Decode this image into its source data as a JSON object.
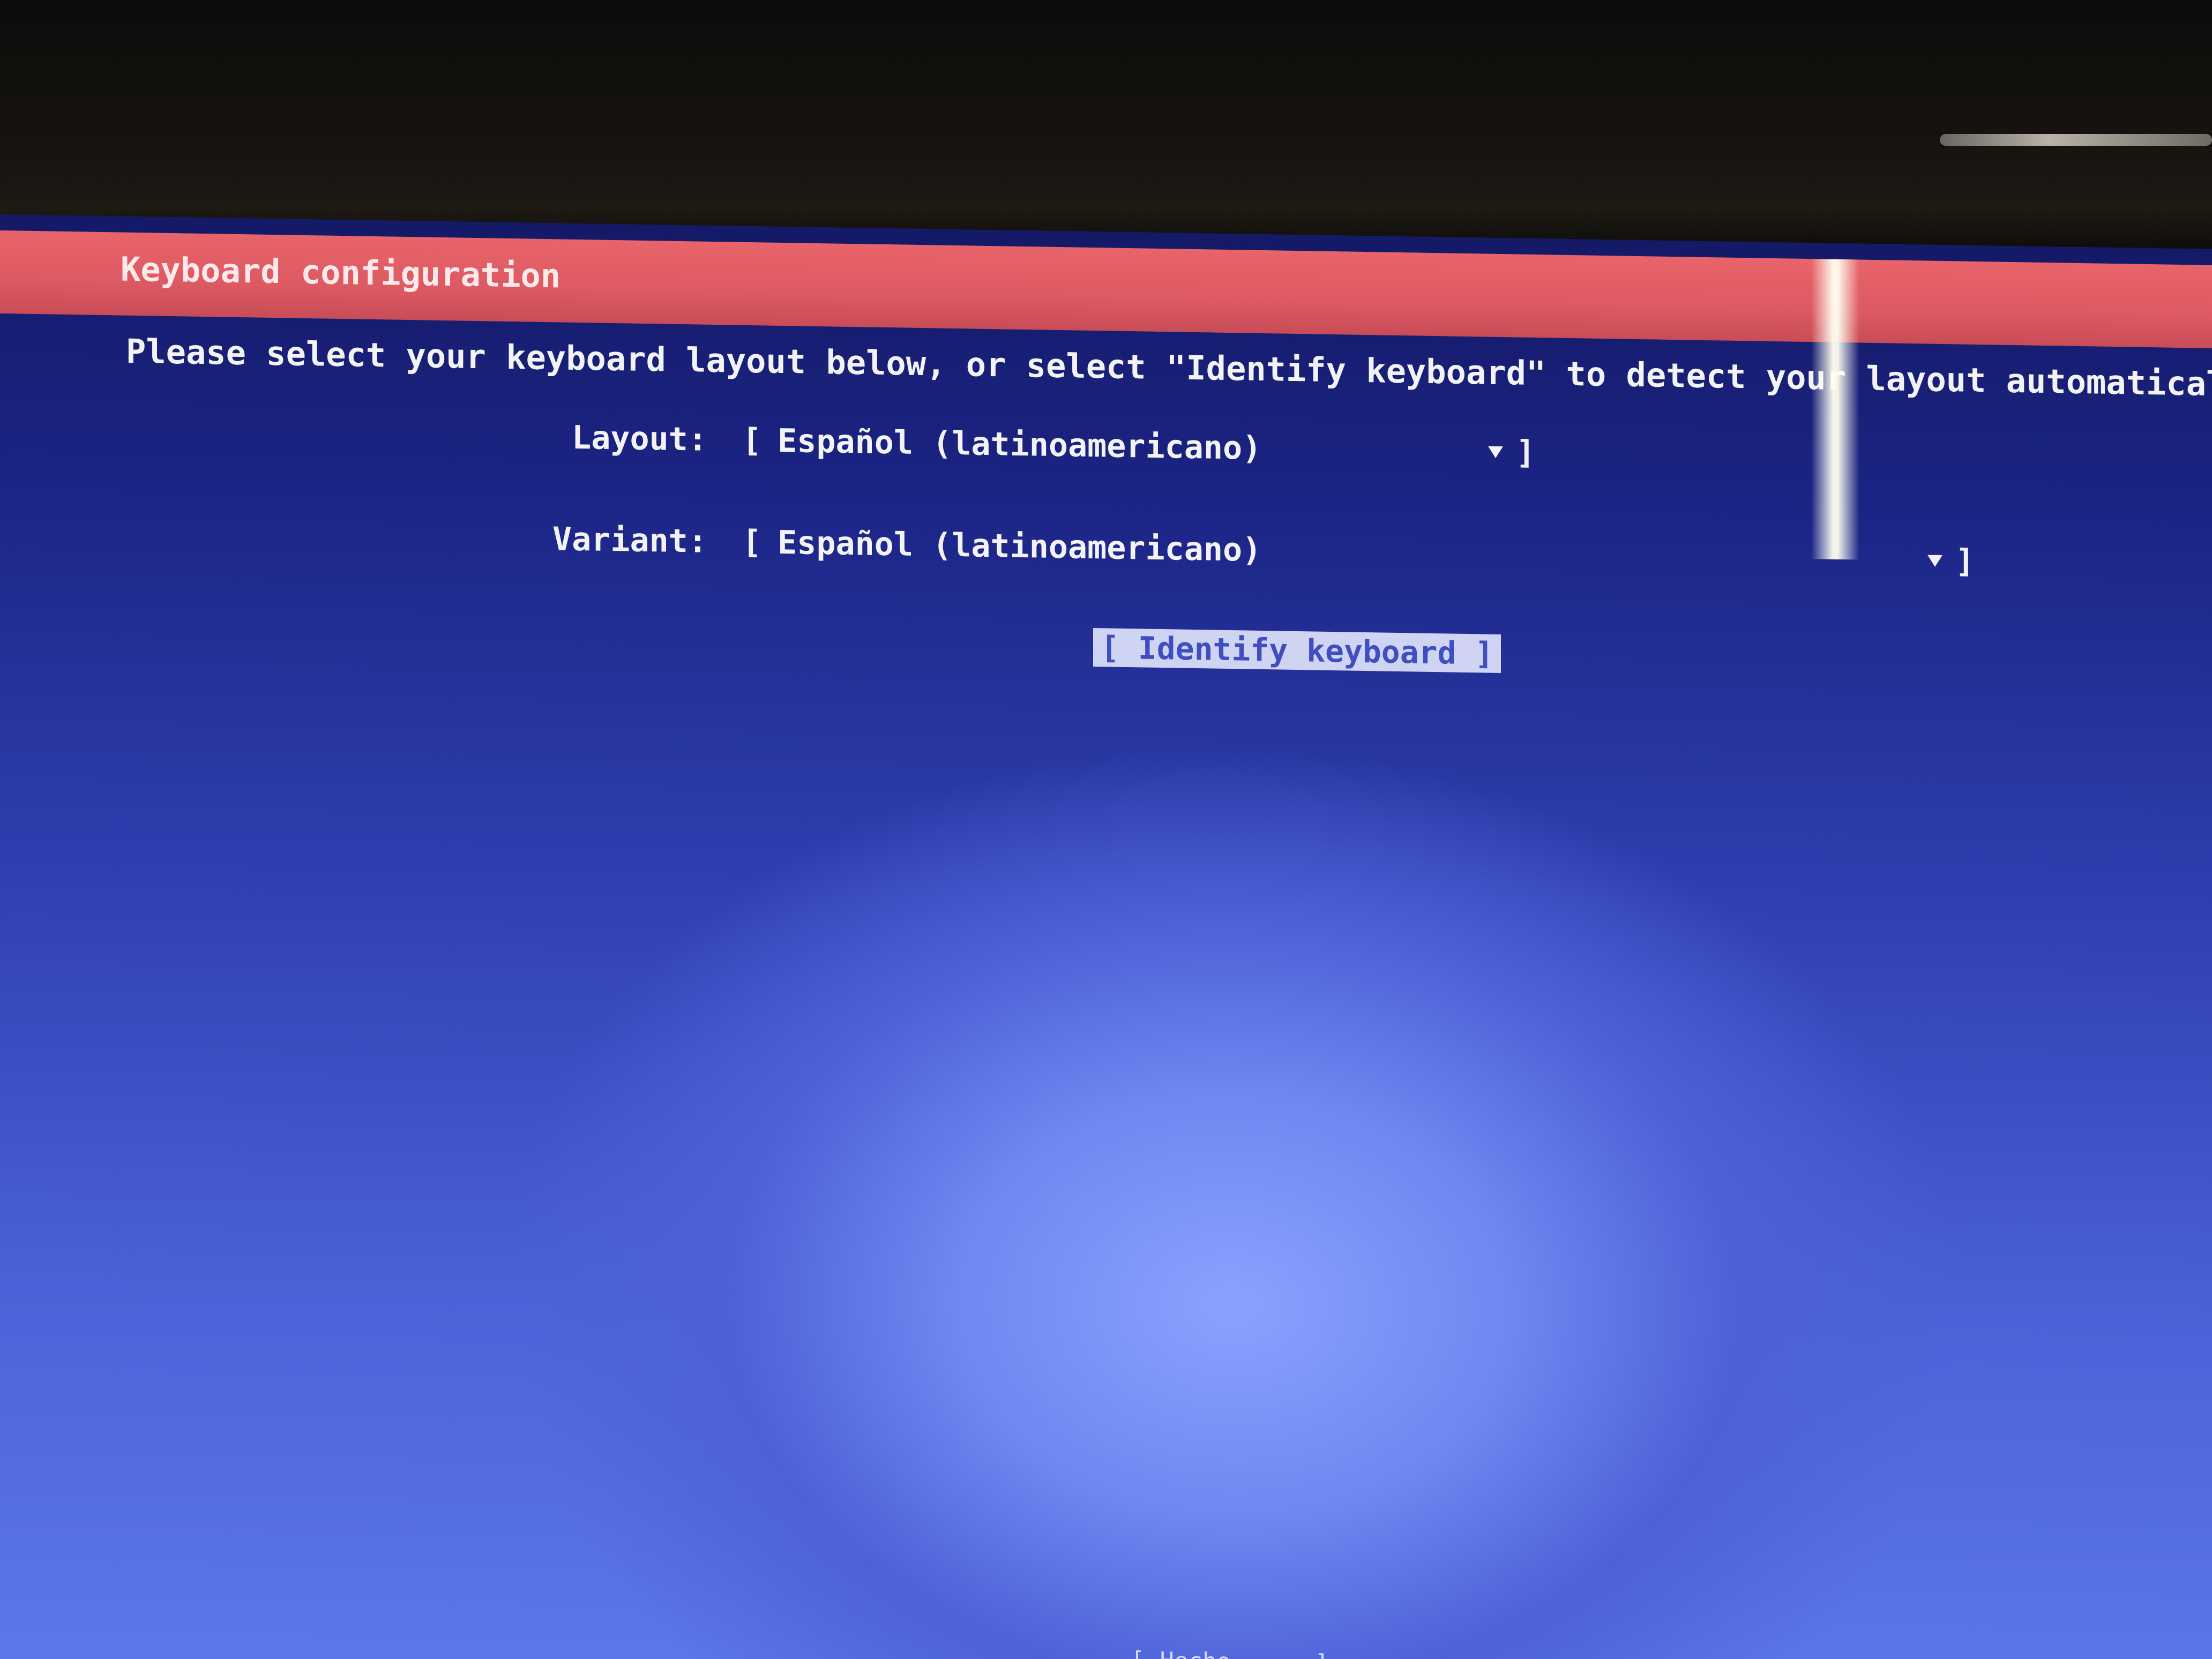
{
  "window": {
    "title": "Keyboard configuration"
  },
  "instructions": "Please select your keyboard layout below, or select \"Identify keyboard\" to detect your layout automatically.",
  "layout": {
    "label": "Layout:",
    "value": "Español (latinoamericano)"
  },
  "variant": {
    "label": "Variant:",
    "value": "Español (latinoamericano)"
  },
  "buttons": {
    "identify": "[ Identify keyboard ]",
    "done": "Hecho"
  },
  "glyphs": {
    "open_bracket": "[",
    "close_bracket": "]"
  },
  "colors": {
    "title_bar": "#dd5a63",
    "background": "#2f3fb0",
    "focused_button_bg": "#cfd4f3",
    "focused_button_fg": "#3f4fc0"
  }
}
